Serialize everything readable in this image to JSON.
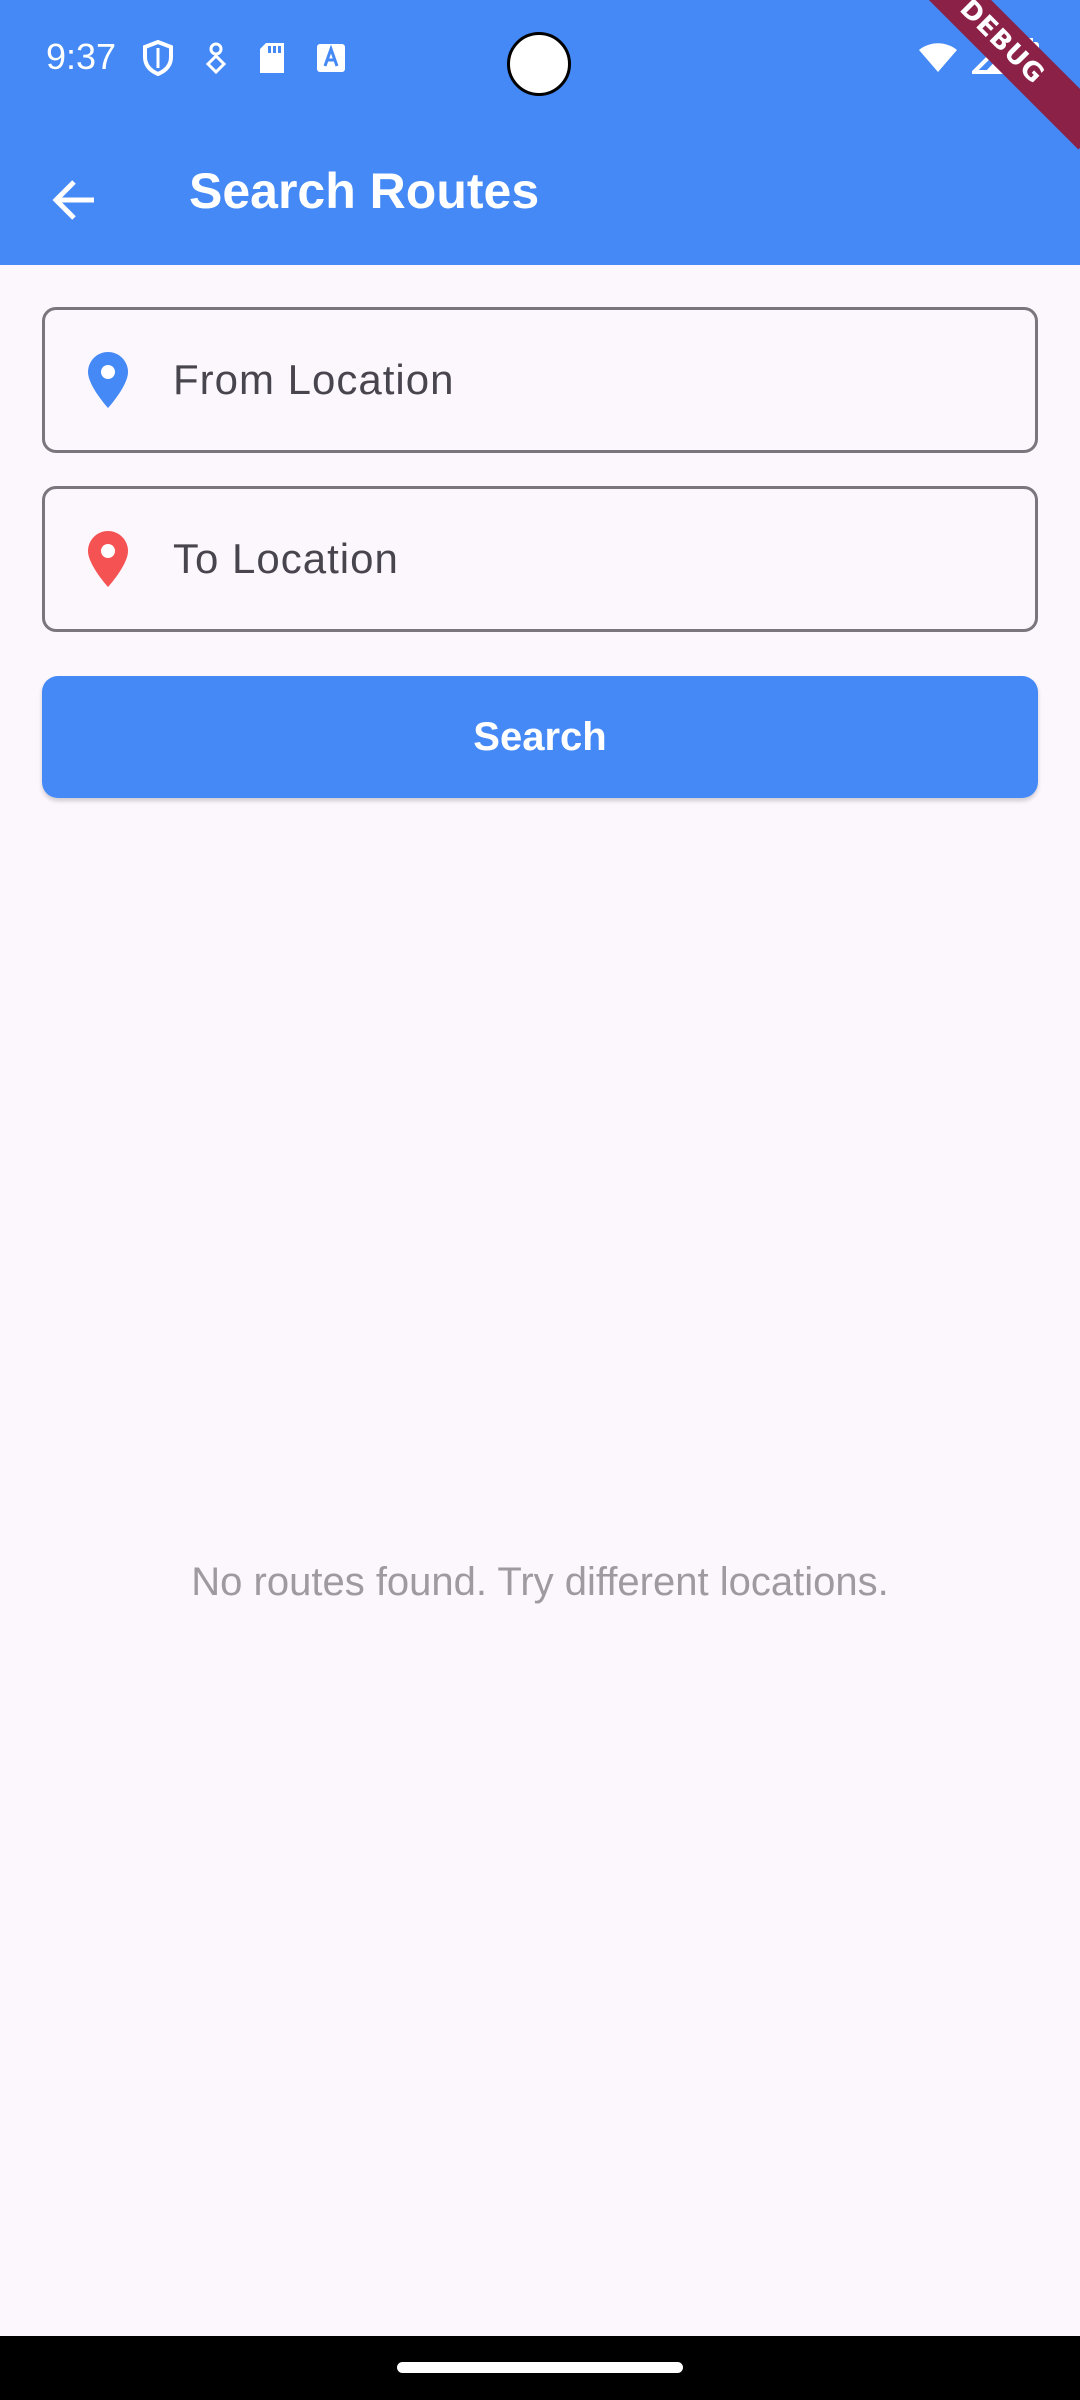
{
  "status_bar": {
    "time": "9:37",
    "left_icons": [
      "shield-icon",
      "location-tracking-icon",
      "sd-card-icon",
      "font-a-icon"
    ],
    "right_icons": [
      "wifi-icon",
      "cell-signal-icon",
      "battery-icon"
    ]
  },
  "debug_banner": "DEBUG",
  "app_bar": {
    "title": "Search Routes",
    "back_icon": "arrow-left-icon",
    "background": "#4489f6"
  },
  "form": {
    "from": {
      "placeholder": "From Location",
      "value": "",
      "icon": "location-pin-icon",
      "icon_color": "#4489f6"
    },
    "to": {
      "placeholder": "To Location",
      "value": "",
      "icon": "location-pin-icon",
      "icon_color": "#f55353"
    },
    "search_label": "Search"
  },
  "results": {
    "empty_message": "No routes found. Try different locations."
  }
}
